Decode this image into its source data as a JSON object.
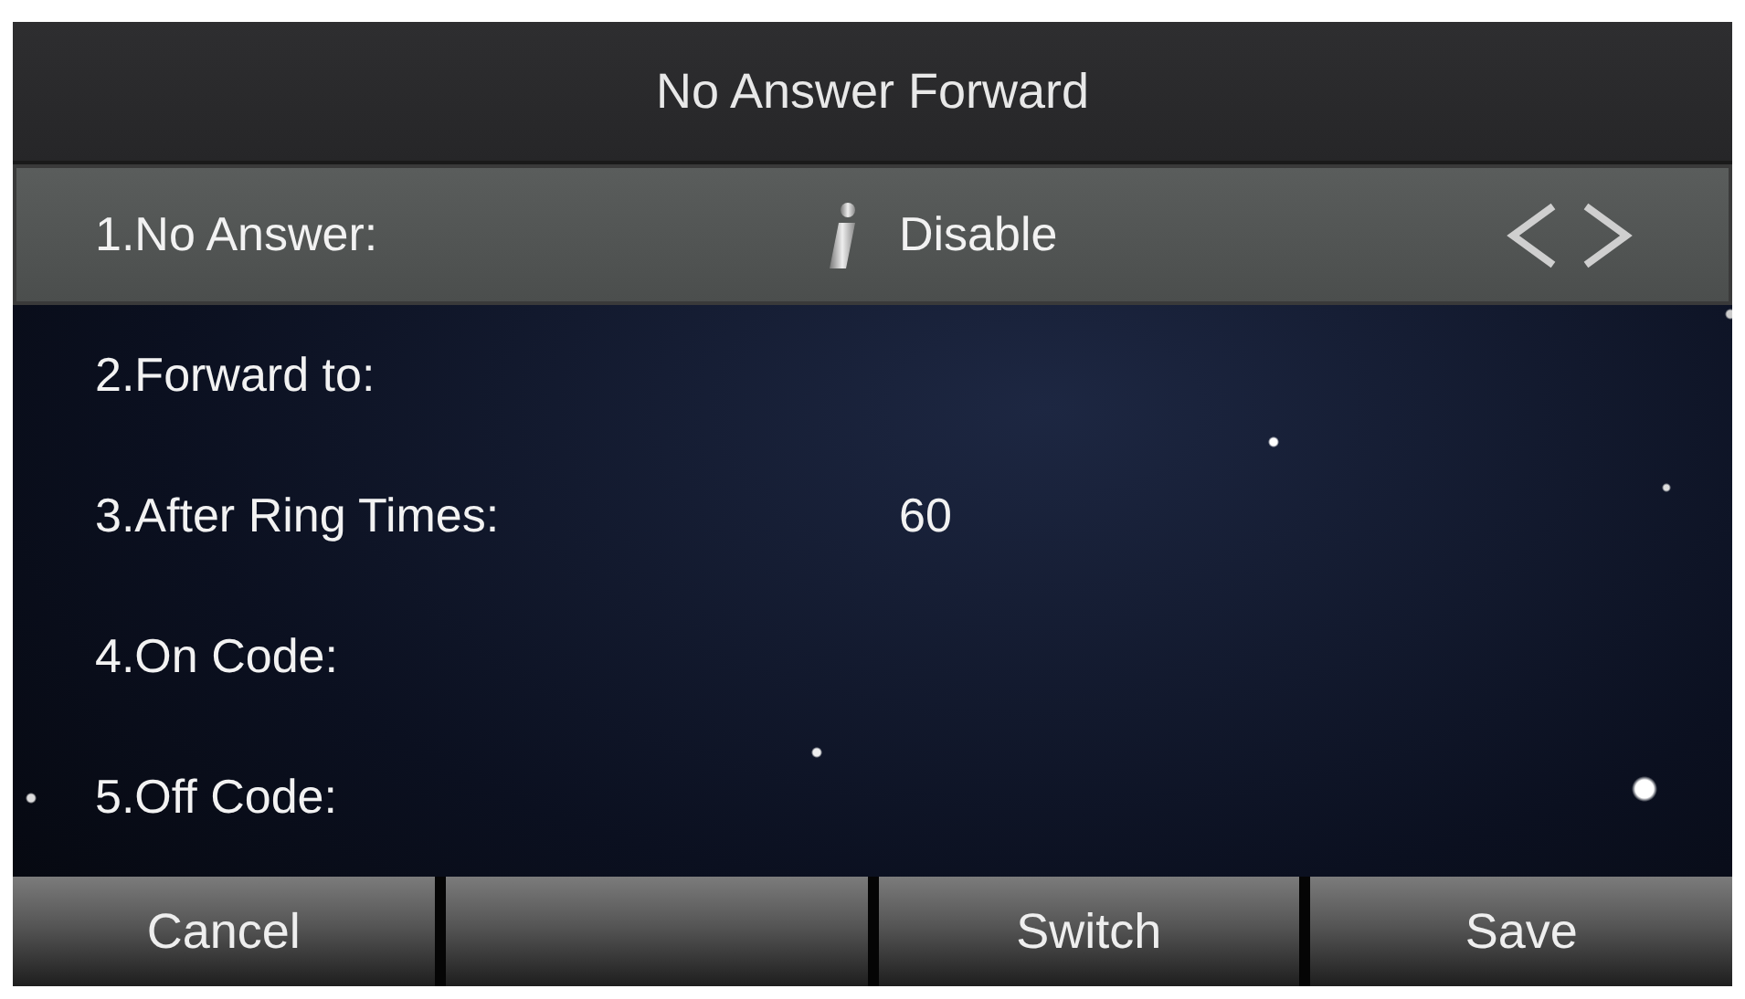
{
  "title": "No Answer Forward",
  "rows": [
    {
      "label": "1.No Answer:",
      "value": "Disable",
      "selected": true
    },
    {
      "label": "2.Forward to:",
      "selected": false
    },
    {
      "label": "3.After Ring Times:",
      "value": "60",
      "selected": false
    },
    {
      "label": "4.On Code:",
      "selected": false
    },
    {
      "label": "5.Off Code:",
      "selected": false
    }
  ],
  "softkeys": [
    {
      "kind": "key",
      "label": "Cancel"
    },
    {
      "kind": "blank"
    },
    {
      "kind": "key",
      "label": "Switch"
    },
    {
      "kind": "key",
      "label": "Save"
    }
  ]
}
